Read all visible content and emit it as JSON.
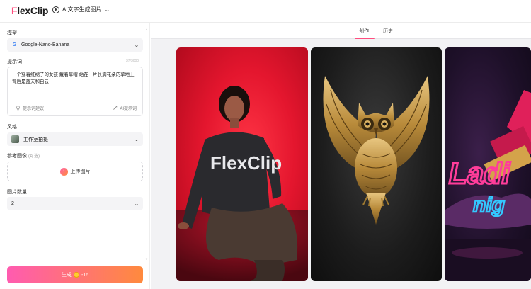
{
  "header": {
    "logo_prefix": "F",
    "logo_rest": "lexClip",
    "tool_name": "AI文字生成图片"
  },
  "sidebar": {
    "model_label": "模型",
    "model_value": "Google-Nano-Banana",
    "prompt_label": "提示词",
    "prompt_counter": "37/3000",
    "prompt_text": "一个穿着红裙子的女孩 戴着草帽 站在一片长满花朵的草地上 背后是蓝天和白云",
    "prompt_suggest": "提示词建议",
    "ai_prompt": "AI提示词",
    "style_label": "风格",
    "style_value": "工作室拍摄",
    "ref_label": "参考图像",
    "ref_hint": "(可选)",
    "upload_label": "上传图片",
    "count_label": "图片数量",
    "count_value": "2",
    "generate_label": "生成",
    "generate_cost": "-16"
  },
  "main": {
    "tab_create": "创作",
    "tab_history": "历史",
    "card1_text": "FlexClip",
    "card3_line1": "Ladi",
    "card3_line2": "nig"
  },
  "colors": {
    "brand": "#ff4d7e",
    "button_start": "#ff5bb0",
    "button_end": "#ff8a3d"
  }
}
